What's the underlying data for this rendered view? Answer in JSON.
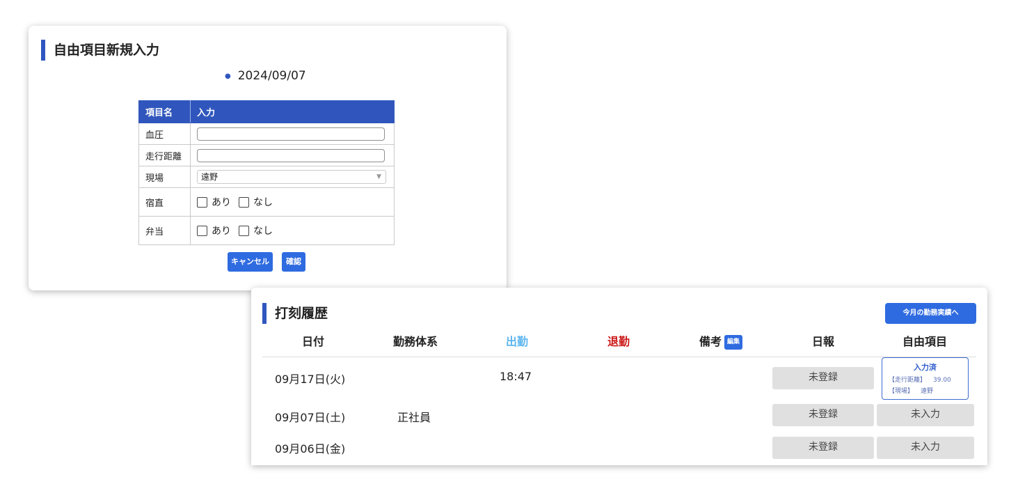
{
  "free_form": {
    "title": "自由項目新規入力",
    "date": "2024/09/07",
    "table": {
      "header_name": "項目名",
      "header_input": "入力",
      "rows": [
        {
          "name": "血圧",
          "type": "text",
          "value": ""
        },
        {
          "name": "走行距離",
          "type": "text",
          "value": ""
        },
        {
          "name": "現場",
          "type": "select",
          "value": "遠野"
        },
        {
          "name": "宿直",
          "type": "checkbox",
          "options": [
            "あり",
            "なし"
          ]
        },
        {
          "name": "弁当",
          "type": "checkbox",
          "options": [
            "あり",
            "なし"
          ]
        }
      ]
    },
    "cancel_label": "キャンセル",
    "confirm_label": "確認"
  },
  "history": {
    "title": "打刻履歴",
    "monthly_button": "今月の勤務実績へ",
    "headers": {
      "date": "日付",
      "work_type": "勤務体系",
      "clock_in": "出勤",
      "clock_out": "退勤",
      "remarks": "備考",
      "edit_badge": "編集",
      "daily_report": "日報",
      "free_items": "自由項目"
    },
    "rows": [
      {
        "date": "09月17日(火)",
        "work_type": "",
        "clock_in": "18:47",
        "daily_report": "未登録",
        "free_status": "入力済",
        "free_details": [
          {
            "label": "【走行距離】",
            "value": "39.00"
          },
          {
            "label": "【現場】",
            "value": "遠野"
          }
        ]
      },
      {
        "date": "09月07日(土)",
        "work_type": "正社員",
        "clock_in": "",
        "daily_report": "未登録",
        "free_status": "未入力"
      },
      {
        "date": "09月06日(金)",
        "work_type": "",
        "clock_in": "",
        "daily_report": "未登録",
        "free_status": "未入力"
      }
    ]
  }
}
